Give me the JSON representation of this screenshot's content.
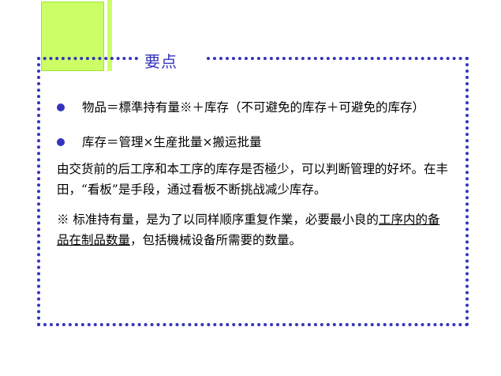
{
  "title": "要点",
  "bullets": [
    {
      "text": "物品＝標準持有量※＋库存（不可避免的库存＋可避免的库存）"
    },
    {
      "text": "库存＝管理×生産批量×搬运批量"
    }
  ],
  "paragraph": "由交货前的后工序和本工序的库存是否極少，可以判断管理的好坏。在丰田，“看板”是手段，通过看板不断挑战减少库存。",
  "note": {
    "prefix": "※ 标准持有量，是为了以同样顺序重复作業，必要最小良的",
    "underlined": "工序内的备品在制品数量",
    "suffix": "，包括機械设备所需要的数量。"
  },
  "colors": {
    "accent_blue": "#3333bb",
    "lime_green": "#ccff66"
  }
}
